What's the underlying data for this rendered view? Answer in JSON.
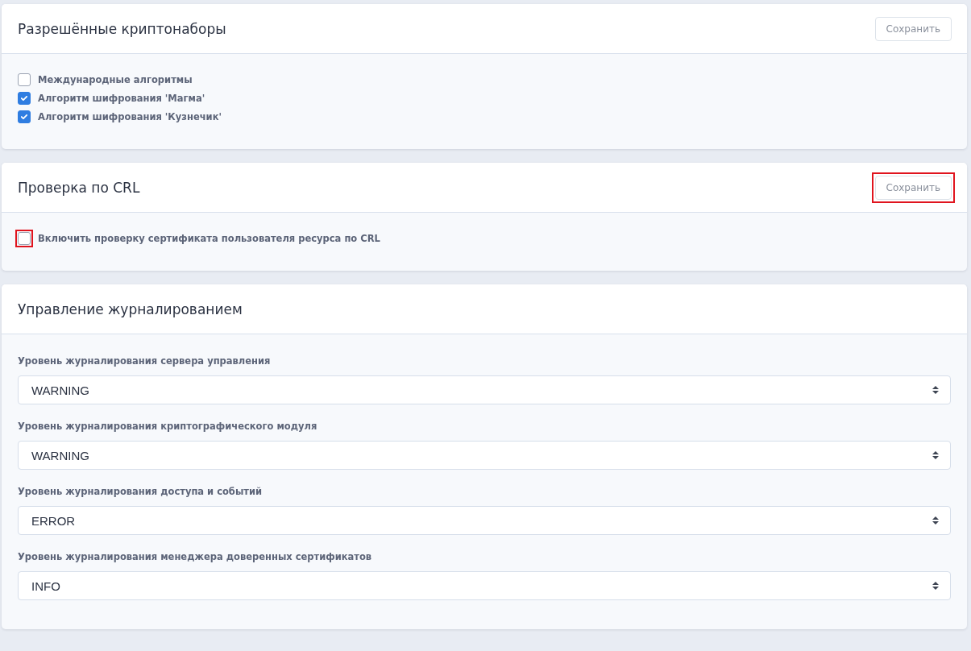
{
  "cards": [
    {
      "title": "Разрешённые криптонаборы",
      "save_button": {
        "label": "Сохранить"
      },
      "checkboxes": [
        {
          "label": "Международные алгоритмы",
          "checked": false
        },
        {
          "label": "Алгоритм шифрования 'Магма'",
          "checked": true
        },
        {
          "label": "Алгоритм шифрования 'Кузнечик'",
          "checked": true
        }
      ]
    },
    {
      "title": "Проверка по CRL",
      "save_button": {
        "label": "Сохранить",
        "highlighted": true
      },
      "checkboxes": [
        {
          "label": "Включить проверку сертификата пользователя ресурса по CRL",
          "checked": false,
          "highlighted": true
        }
      ]
    },
    {
      "title": "Управление журналированием",
      "selects": [
        {
          "label": "Уровень журналирования сервера управления",
          "value": "WARNING"
        },
        {
          "label": "Уровень журналирования криптографического модуля",
          "value": "WARNING"
        },
        {
          "label": "Уровень журналирования доступа и событий",
          "value": "ERROR"
        },
        {
          "label": "Уровень журналирования менеджера доверенных сертификатов",
          "value": "INFO"
        }
      ]
    }
  ]
}
